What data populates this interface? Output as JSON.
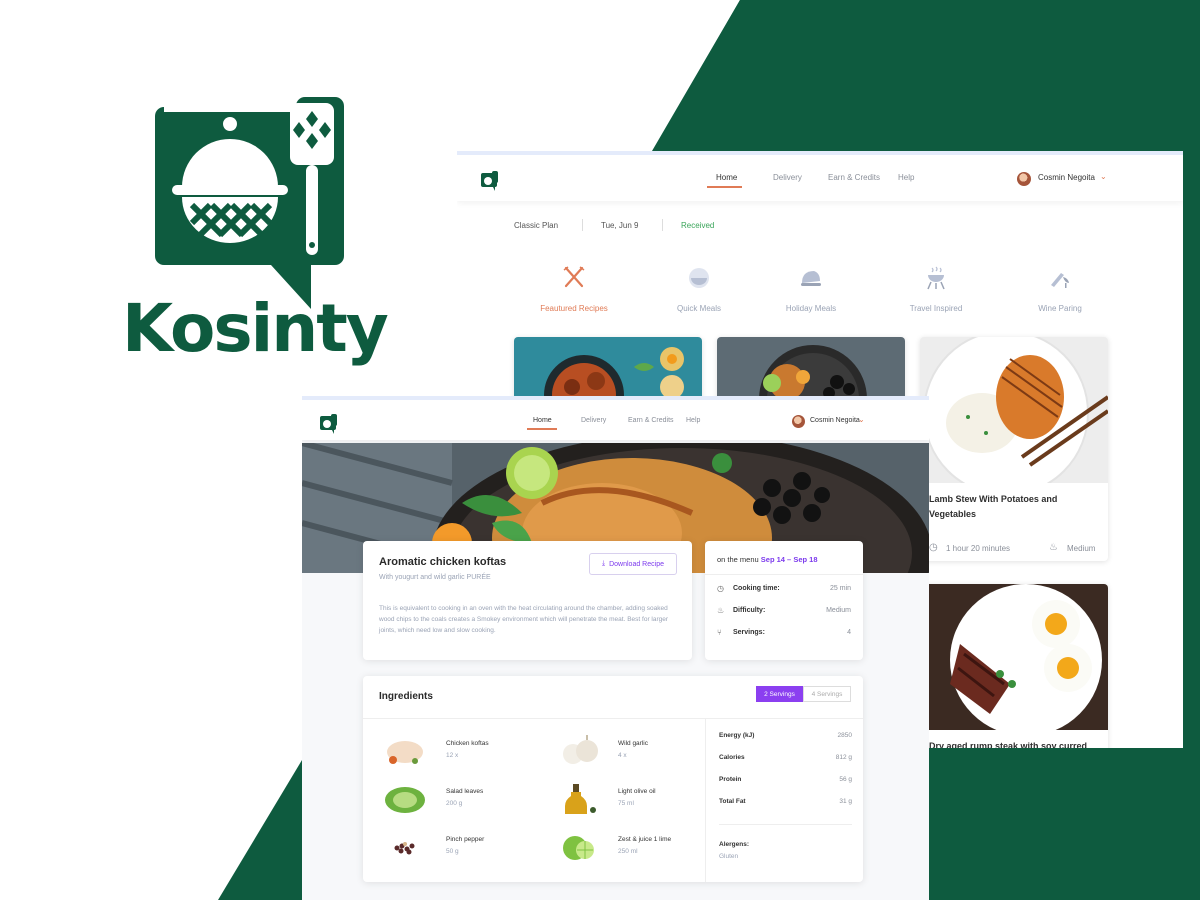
{
  "brand": {
    "name": "Kosinty",
    "color": "#0e5b3f"
  },
  "colors": {
    "accent_orange": "#e07b56",
    "accent_purple": "#7c3aed",
    "brand_green": "#0e5b3f"
  },
  "nav": {
    "items": [
      "Home",
      "Delivery",
      "Earn & Credits",
      "Help"
    ],
    "active": "Home",
    "user_name": "Cosmin Negoita"
  },
  "plan": {
    "name": "Classic Plan",
    "date": "Tue, Jun 9",
    "status": "Received"
  },
  "categories": [
    {
      "label": "Feautured Recipes",
      "icon": "fork-knife-icon",
      "active": true
    },
    {
      "label": "Quick Meals",
      "icon": "bowl-icon",
      "active": false
    },
    {
      "label": "Holiday Meals",
      "icon": "turkey-icon",
      "active": false
    },
    {
      "label": "Travel Inspired",
      "icon": "grill-icon",
      "active": false
    },
    {
      "label": "Wine Paring",
      "icon": "wine-icon",
      "active": false
    }
  ],
  "cards": [
    {
      "title": "Lamb Stew With Potatoes and Vegetables",
      "time": "1 hour 20 minutes",
      "difficulty": "Medium"
    },
    {
      "title": "Dry aged rump steak with soy curred"
    }
  ],
  "recipe": {
    "title": "Aromatic chicken koftas",
    "subtitle": "With yougurt and wild garlic PURÉE",
    "download_label": "Download Recipe",
    "description": "This is equivalent to cooking in an oven with the heat circulating around the chamber, adding soaked wood chips to the coals creates a Smokey environment which will penetrate the meat. Best for larger joints, which need low and slow cooking."
  },
  "menu": {
    "label": "on the menu",
    "dates": "Sep 14 – Sep 18",
    "stats": [
      {
        "label": "Cooking time:",
        "value": "25 min",
        "icon": "clock-icon"
      },
      {
        "label": "Difficulty:",
        "value": "Medium",
        "icon": "chef-hat-icon"
      },
      {
        "label": "Servings:",
        "value": "4",
        "icon": "utensils-icon"
      }
    ]
  },
  "ingredients": {
    "title": "Ingredients",
    "servings_options": [
      "2 Servings",
      "4 Servings"
    ],
    "selected_serving": "2 Servings",
    "items": [
      {
        "name": "Chicken koftas",
        "qty": "12 x",
        "icon": "chicken-icon"
      },
      {
        "name": "Wild garlic",
        "qty": "4 x",
        "icon": "garlic-icon"
      },
      {
        "name": "Salad leaves",
        "qty": "200 g",
        "icon": "lettuce-icon"
      },
      {
        "name": "Light olive oil",
        "qty": "75 ml",
        "icon": "olive-oil-icon"
      },
      {
        "name": "Pinch pepper",
        "qty": "50 g",
        "icon": "pepper-icon"
      },
      {
        "name": "Zest & juice 1 lime",
        "qty": "250 ml",
        "icon": "lime-icon"
      }
    ],
    "nutrition": [
      {
        "label": "Energy (kJ)",
        "value": "2850"
      },
      {
        "label": "Calories",
        "value": "812 g"
      },
      {
        "label": "Protein",
        "value": "56 g"
      },
      {
        "label": "Total Fat",
        "value": "31 g"
      }
    ],
    "allergens_label": "Alergens:",
    "allergens": "Gluten"
  }
}
